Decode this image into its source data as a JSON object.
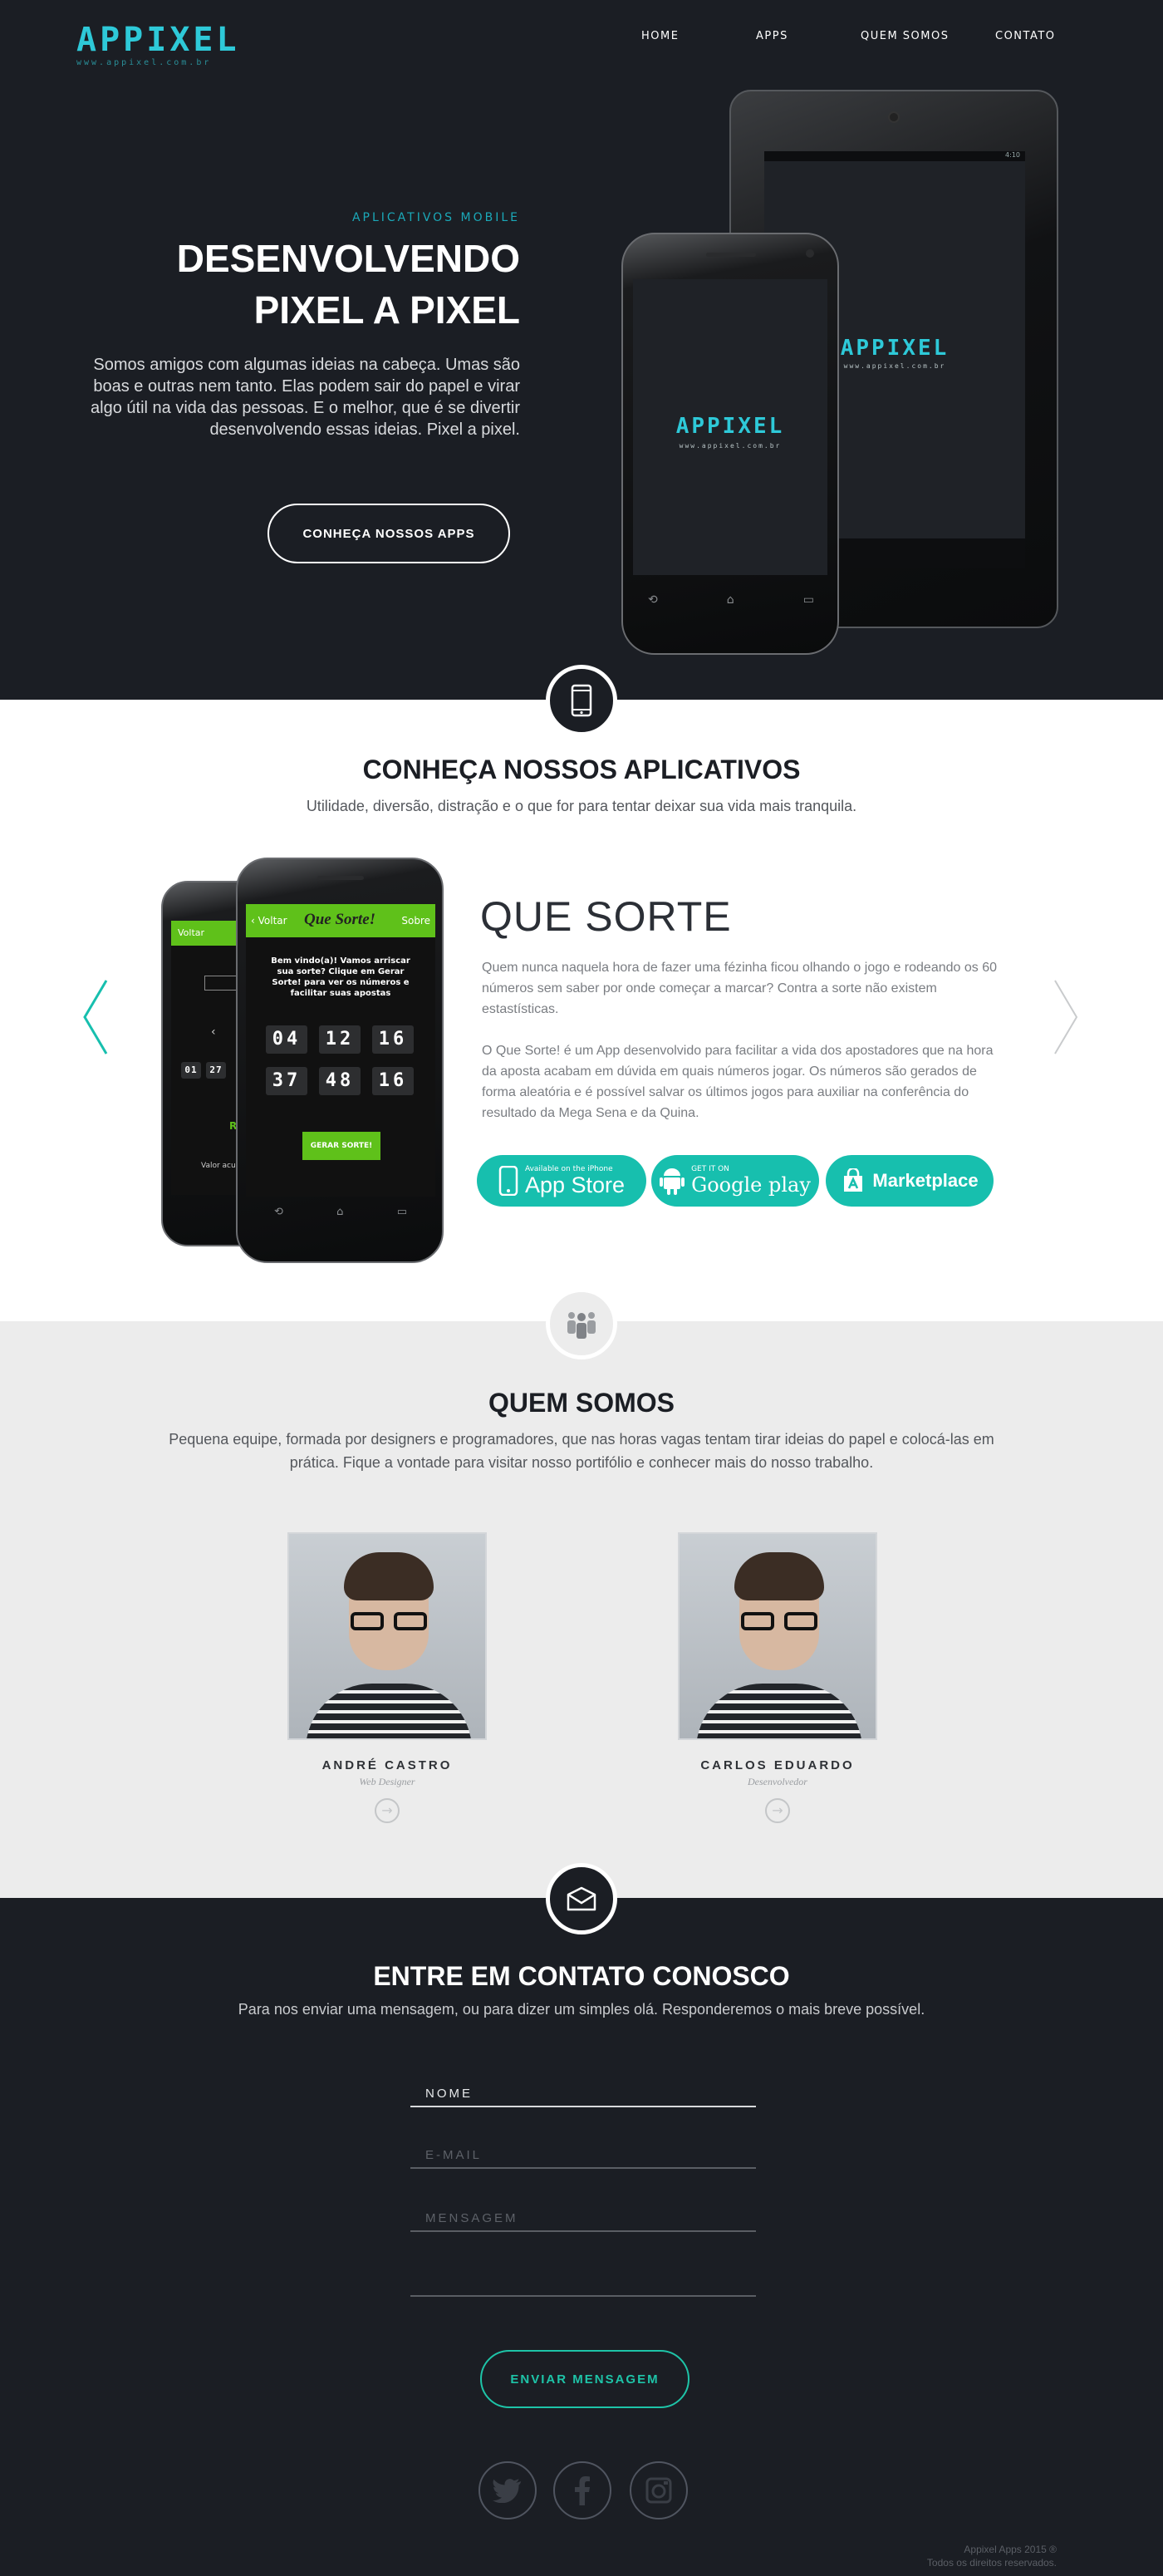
{
  "header": {
    "logo": "APPIXEL",
    "logo_sub": "www.appixel.com.br",
    "nav": [
      {
        "label": "HOME"
      },
      {
        "label": "APPS"
      },
      {
        "label": "QUEM SOMOS"
      },
      {
        "label": "CONTATO"
      }
    ]
  },
  "hero": {
    "kicker": "APLICATIVOS MOBILE",
    "title_line1": "DESENVOLVENDO",
    "title_line2": "PIXEL A PIXEL",
    "text": "Somos amigos com algumas ideias na cabeça. Umas são boas e outras nem tanto. Elas podem sair do papel e virar algo útil na vida das pessoas. E o melhor, que é se divertir desenvolvendo essas ideias. Pixel a pixel.",
    "button": "CONHEÇA NOSSOS APPS",
    "device_logo": "APPIXEL",
    "device_sub": "www.appixel.com.br",
    "status_time": "4:10"
  },
  "apps": {
    "title": "CONHEÇA NOSSOS APLICATIVOS",
    "subtitle": "Utilidade, diversão, distração e o que for para tentar deixar sua vida mais tranquila.",
    "app_name": "QUE SORTE",
    "desc1": "Quem nunca naquela hora de fazer uma fézinha ficou olhando o jogo e rodeando os 60 números sem saber por onde começar a marcar? Contra a sorte não existem estastísticas.",
    "desc2": "O Que Sorte! é um App desenvolvido para facilitar a vida dos apostadores que na hora da aposta acabam em dúvida em quais números jogar. Os números são gerados de forma aleatória e é possível salvar os últimos jogos para auxiliar na conferência do resultado da Mega Sena e da Quina.",
    "screen": {
      "back": "Voltar",
      "app_title": "Que Sorte!",
      "about": "Sobre",
      "welcome": "Bem vindo(a)! Vamos arriscar sua sorte? Clique em Gerar Sorte! para ver os números e facilitar suas apostas",
      "numbers": [
        "04",
        "12",
        "16",
        "37",
        "48",
        "16"
      ],
      "generate": "GERAR SORTE!",
      "back_numbers": [
        "01",
        "27"
      ],
      "back_value_label": "Valor acumulado",
      "back_value": "R$"
    },
    "stores": [
      {
        "small": "Available on the iPhone",
        "big": "App Store"
      },
      {
        "small": "GET IT ON",
        "big": "Google play"
      },
      {
        "small": "",
        "big": "Marketplace"
      }
    ]
  },
  "team": {
    "title": "QUEM SOMOS",
    "subtitle": "Pequena equipe, formada por designers e programadores, que nas horas vagas tentam tirar ideias do papel e colocá-las em prática. Fique a vontade para visitar nosso portifólio e conhecer mais do nosso trabalho.",
    "members": [
      {
        "name": "ANDRÉ CASTRO",
        "role": "Web Designer"
      },
      {
        "name": "CARLOS EDUARDO",
        "role": "Desenvolvedor"
      }
    ]
  },
  "contact": {
    "title": "ENTRE EM  CONTATO CONOSCO",
    "subtitle": "Para nos enviar uma mensagem, ou para dizer um simples olá. Responderemos o mais breve possível.",
    "name_placeholder": "NOME",
    "email_placeholder": "E-MAIL",
    "message_placeholder": "MENSAGEM",
    "send": "ENVIAR MENSAGEM",
    "copyright_line1": "Appixel Apps 2015 ®",
    "copyright_line2": "Todos os direitos reservados."
  },
  "colors": {
    "brand_cyan": "#2ec9d8",
    "store_teal": "#17bfae",
    "dark_bg": "#1b1e24",
    "app_green": "#5fc11a"
  },
  "icons": [
    "phone-icon",
    "team-icon",
    "envelope-icon",
    "twitter-icon",
    "facebook-icon",
    "instagram-icon",
    "arrow-left-icon",
    "arrow-right-icon",
    "apple-icon",
    "android-icon",
    "marketplace-icon"
  ]
}
